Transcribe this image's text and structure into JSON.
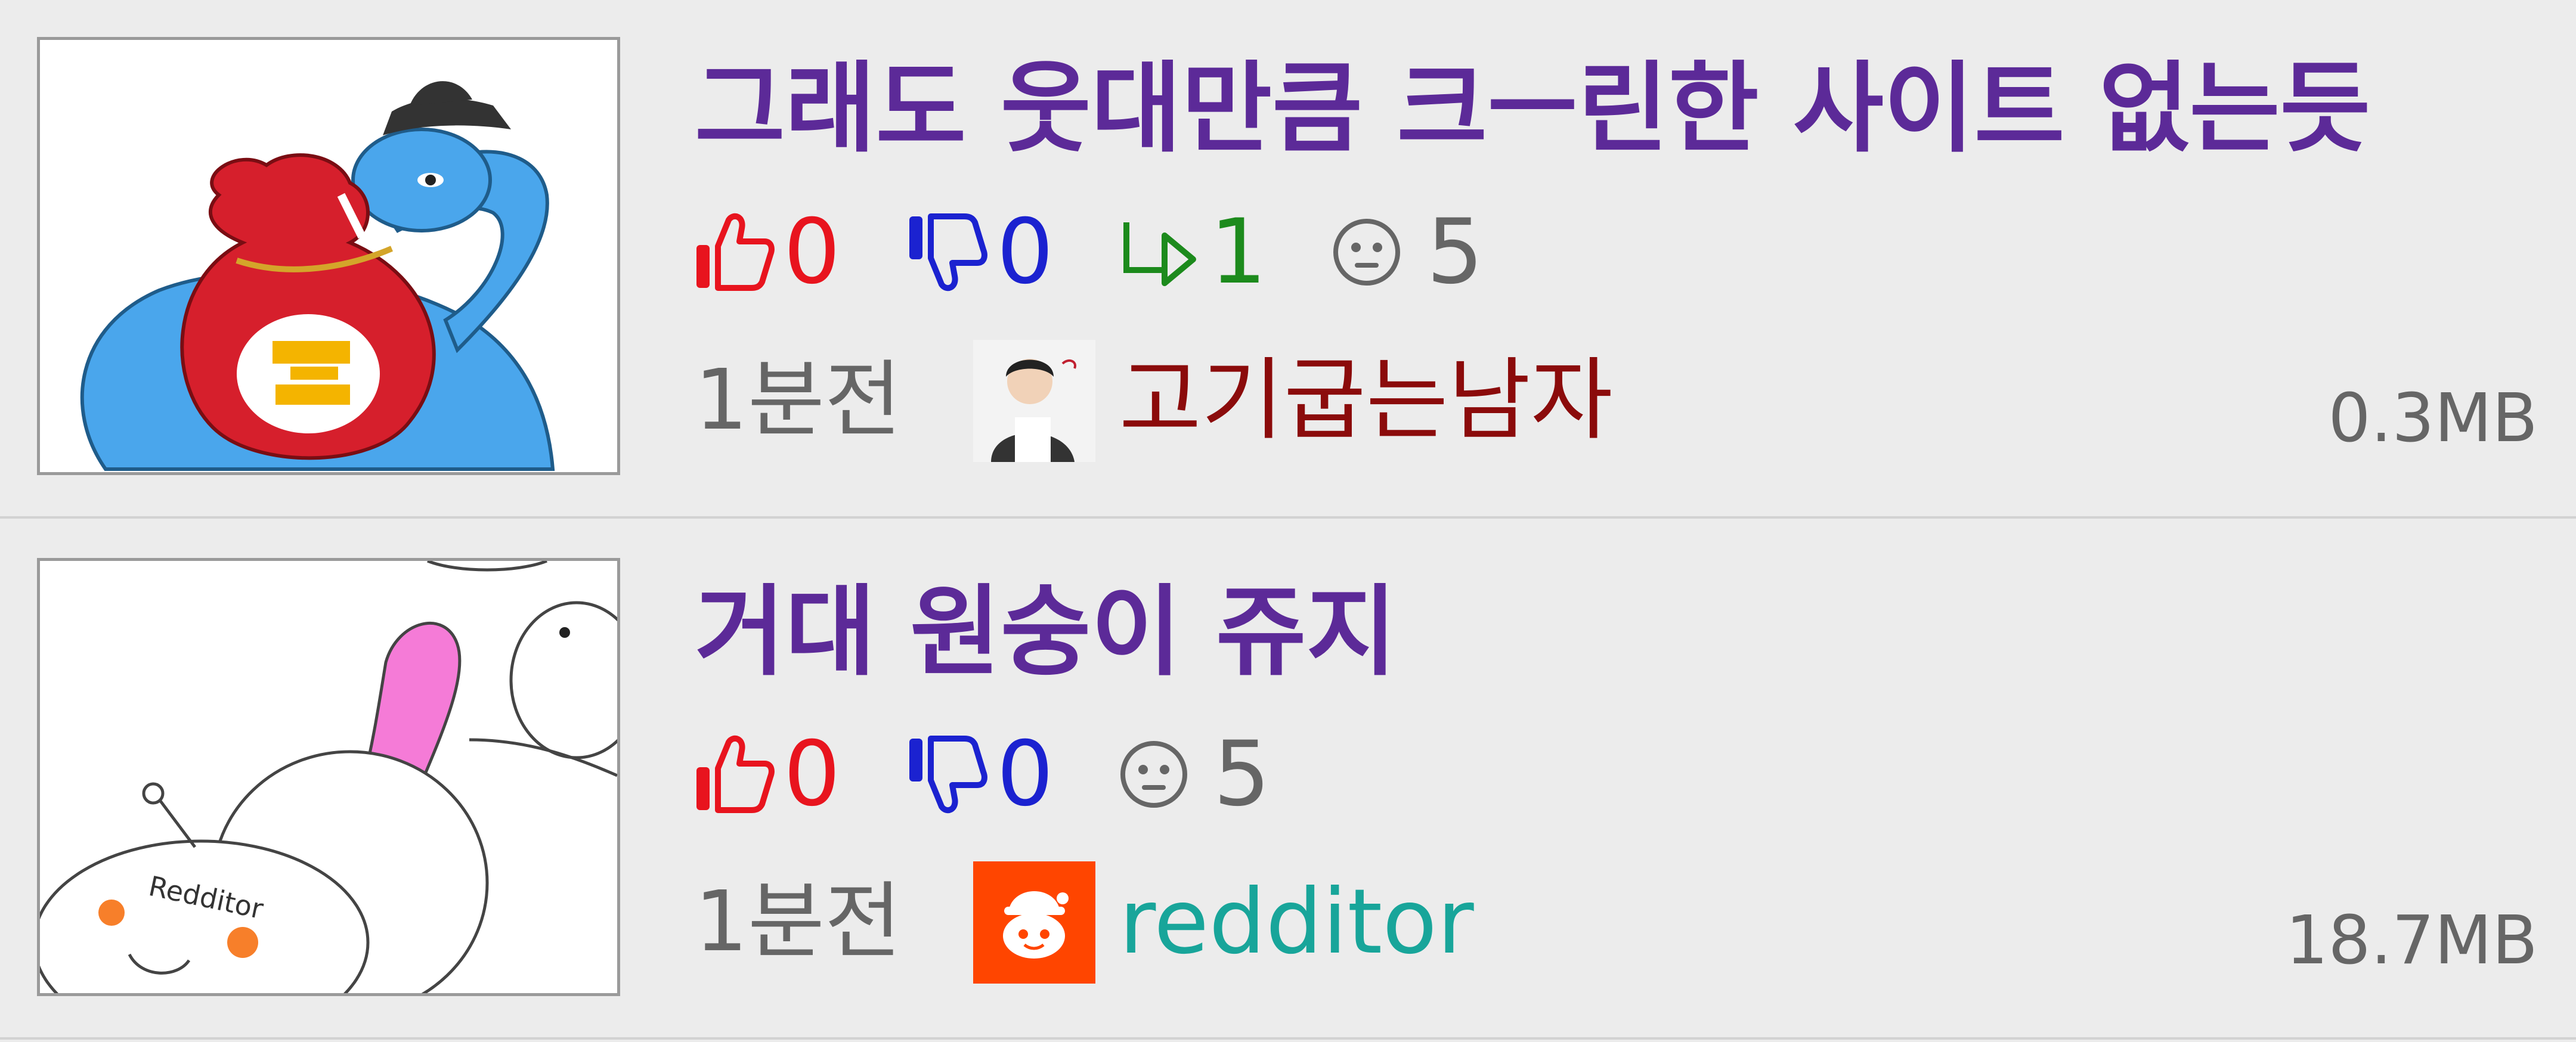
{
  "posts": [
    {
      "title": "그래도 웃대만큼 크ㅡ린한 사이트 없는듯",
      "upvotes": "0",
      "downvotes": "0",
      "shares": "1",
      "comments": "5",
      "time": "1분전",
      "author": "고기굽는남자",
      "size": "0.3MB"
    },
    {
      "title": "거대 원숭이 쥬지",
      "upvotes": "0",
      "downvotes": "0",
      "comments": "5",
      "time": "1분전",
      "author": "redditor",
      "size": "18.7MB",
      "thumbnail_text": "Redditor"
    }
  ],
  "colors": {
    "title": "#5c2a98",
    "upvote": "#e8141e",
    "downvote": "#1b22d0",
    "share": "#1c8a1c",
    "author1": "#8b0b0b",
    "author2": "#18a59a",
    "reddit": "#ff4500"
  }
}
